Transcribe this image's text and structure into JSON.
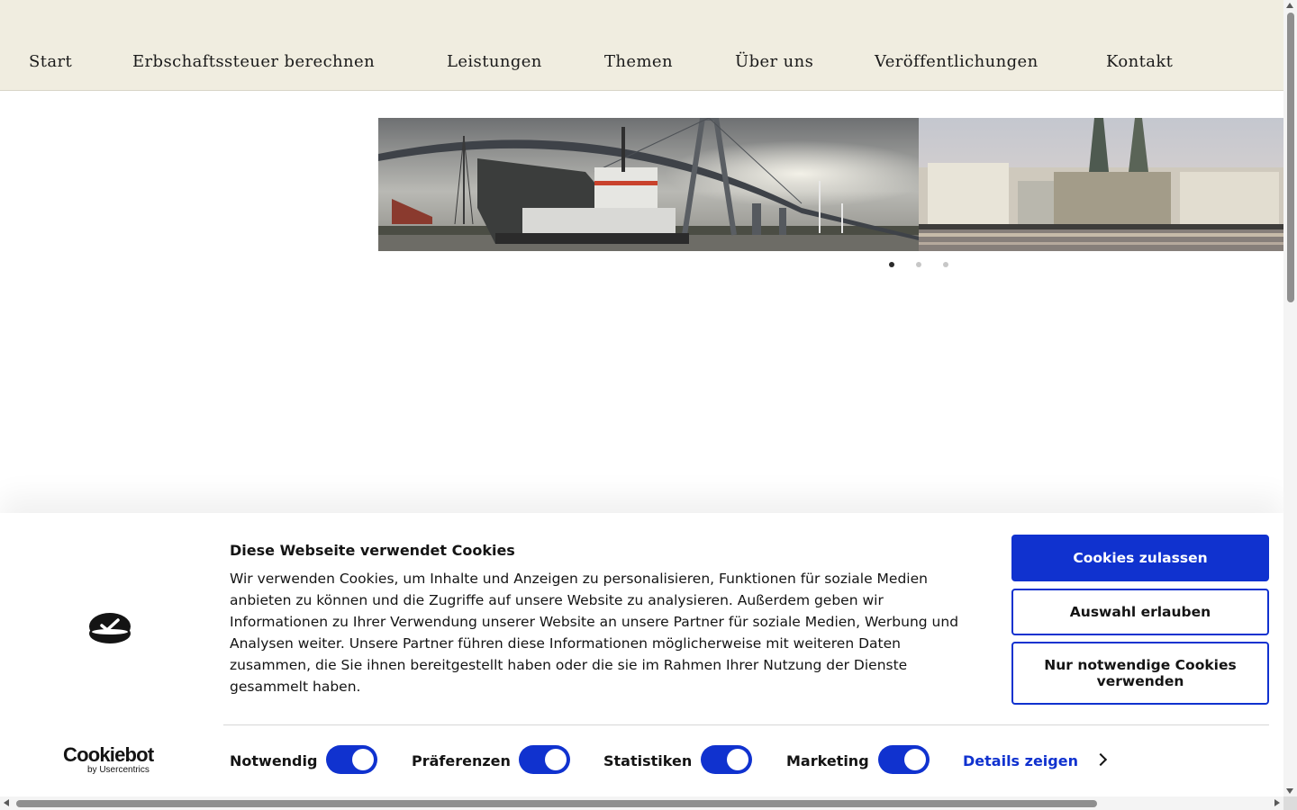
{
  "nav": {
    "items": [
      {
        "label": "Start"
      },
      {
        "label": "Erbschaftssteuer berechnen"
      },
      {
        "label": "Leistungen"
      },
      {
        "label": "Themen"
      },
      {
        "label": "Über uns"
      },
      {
        "label": "Veröffentlichungen"
      },
      {
        "label": "Kontakt"
      }
    ]
  },
  "slider": {
    "slides": [
      {
        "subject": "harbor-dredger-bridge"
      },
      {
        "subject": "hamburg-city-hall-skyline"
      }
    ],
    "dots": 3,
    "active_dot": 0
  },
  "cookie_banner": {
    "brand": "Cookiebot",
    "brand_sub": "by Usercentrics",
    "title": "Diese Webseite verwendet Cookies",
    "text": "Wir verwenden Cookies, um Inhalte und Anzeigen zu personalisieren, Funktionen für soziale Medien anbieten zu können und die Zugriffe auf unsere Website zu analysieren. Außerdem geben wir Informationen zu Ihrer Verwendung unserer Website an unsere Partner für soziale Medien, Werbung und Analysen weiter. Unsere Partner führen diese Informationen möglicherweise mit weiteren Daten zusammen, die Sie ihnen bereitgestellt haben oder die sie im Rahmen Ihrer Nutzung der Dienste gesammelt haben.",
    "toggles": [
      {
        "label": "Notwendig",
        "on": true
      },
      {
        "label": "Präferenzen",
        "on": true
      },
      {
        "label": "Statistiken",
        "on": true
      },
      {
        "label": "Marketing",
        "on": true
      }
    ],
    "details_label": "Details zeigen",
    "buttons": {
      "allow_all": "Cookies zulassen",
      "allow_selection": "Auswahl erlauben",
      "necessary_only": "Nur notwendige Cookies verwenden"
    }
  },
  "colors": {
    "header_bg": "#f0ede0",
    "accent": "#1032cf",
    "text": "#141414"
  }
}
